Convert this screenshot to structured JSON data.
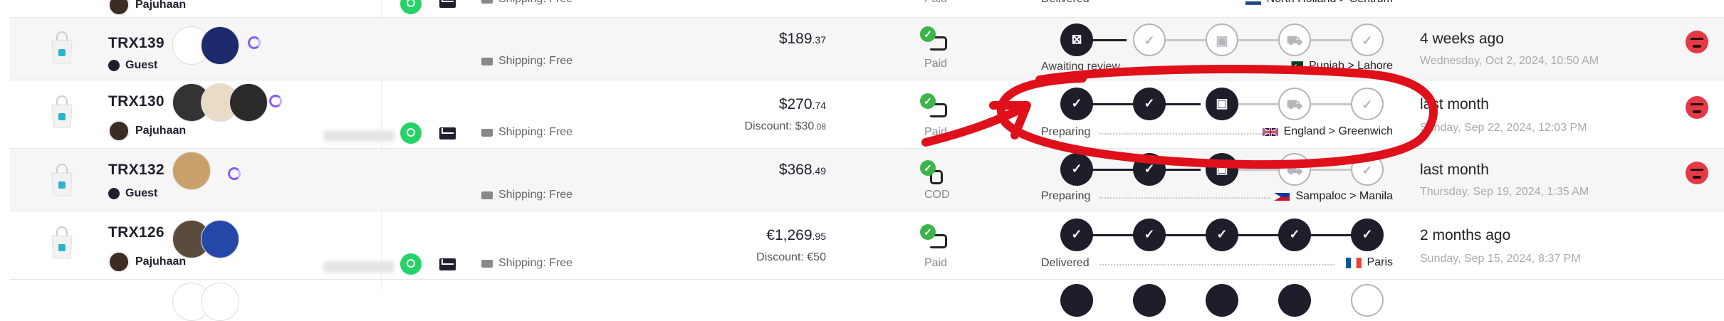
{
  "top_partial": {
    "customer": "Pajuhaan",
    "shipping": "Shipping: Free",
    "payment": "Paid",
    "status": "Delivered",
    "location": "North Holland > Centrum"
  },
  "orders": [
    {
      "id": "TRX139",
      "customer": "Guest",
      "shipping": "Shipping: Free",
      "price_main": "$189",
      "price_cents": ".37",
      "discount_label": "",
      "discount_main": "",
      "discount_cents": "",
      "payment": "Paid",
      "status": "Awaiting review",
      "location": "Punjab > Lahore",
      "ago": "4 weeks ago",
      "date": "Wednesday, Oct 2, 2024, 10:50 AM"
    },
    {
      "id": "TRX130",
      "customer": "Pajuhaan",
      "shipping": "Shipping: Free",
      "price_main": "$270",
      "price_cents": ".74",
      "discount_label": "Discount:",
      "discount_main": "$30",
      "discount_cents": ".08",
      "payment": "Paid",
      "status": "Preparing",
      "location": "England > Greenwich",
      "ago": "last month",
      "date": "Sunday, Sep 22, 2024, 12:03 PM"
    },
    {
      "id": "TRX132",
      "customer": "Guest",
      "shipping": "Shipping: Free",
      "price_main": "$368",
      "price_cents": ".49",
      "discount_label": "",
      "discount_main": "",
      "discount_cents": "",
      "payment": "COD",
      "status": "Preparing",
      "location": "Sampaloc > Manila",
      "ago": "last month",
      "date": "Thursday, Sep 19, 2024, 1:35 AM"
    },
    {
      "id": "TRX126",
      "customer": "Pajuhaan",
      "shipping": "Shipping: Free",
      "price_main": "€1,269",
      "price_cents": ".95",
      "discount_label": "Discount:",
      "discount_main": "€50",
      "discount_cents": "",
      "payment": "Paid",
      "status": "Delivered",
      "location": "Paris",
      "ago": "2 months ago",
      "date": "Sunday, Sep 15, 2024, 8:37 PM"
    }
  ],
  "colors": {
    "accent": "#8a5cf6",
    "dark": "#1e1e2b",
    "paid_green": "#3bb54a",
    "annotation_red": "#e0101a",
    "angry": "#e53945",
    "whatsapp": "#25d366"
  }
}
